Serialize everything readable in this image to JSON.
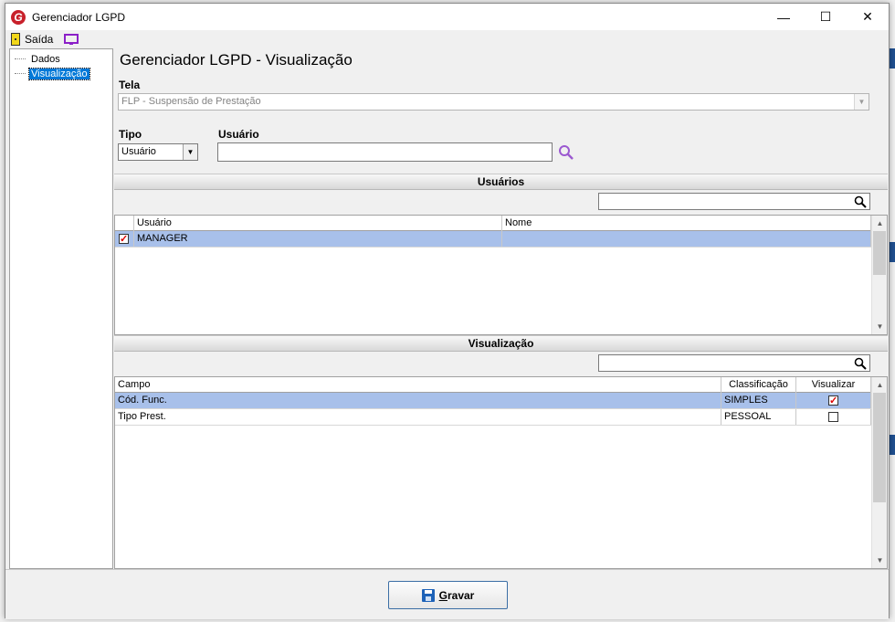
{
  "window": {
    "title": "Gerenciador LGPD",
    "min": "—",
    "max": "☐",
    "close": "✕"
  },
  "toolbar": {
    "exit_label": "Saída"
  },
  "tree": {
    "items": [
      {
        "label": "Dados"
      },
      {
        "label": "Visualização"
      }
    ]
  },
  "main": {
    "heading": "Gerenciador LGPD - Visualização",
    "tela_label": "Tela",
    "tela_value": "FLP - Suspensão de Prestação",
    "tipo_label": "Tipo",
    "tipo_value": "Usuário",
    "usuario_label": "Usuário",
    "usuario_value": ""
  },
  "users_section": {
    "title": "Usuários",
    "columns": [
      "Usuário",
      "Nome"
    ],
    "rows": [
      {
        "checked": true,
        "usuario": "MANAGER",
        "nome": ""
      }
    ]
  },
  "view_section": {
    "title": "Visualização",
    "columns": [
      "Campo",
      "Classificação",
      "Visualizar"
    ],
    "rows": [
      {
        "campo": "Cód. Func.",
        "classificacao": "SIMPLES",
        "visualizar": true
      },
      {
        "campo": "Tipo Prest.",
        "classificacao": "PESSOAL",
        "visualizar": false
      }
    ]
  },
  "footer": {
    "save_first": "G",
    "save_rest": "ravar"
  },
  "colors": {
    "selection": "#a8c0ea",
    "tree_selection": "#0078d7",
    "accent": "#3b6ea5"
  }
}
